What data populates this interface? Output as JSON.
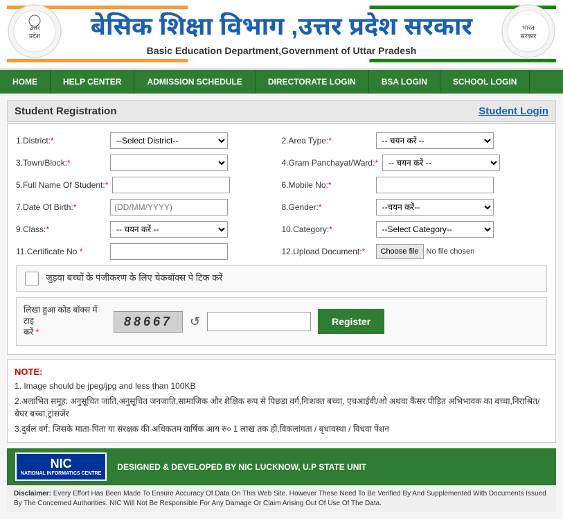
{
  "header": {
    "title": "बेसिक शिक्षा विभाग ,उत्तर प्रदेश सरकार",
    "subtitle": "Basic Education Department,Government of Uttar Pradesh"
  },
  "nav": {
    "items": [
      {
        "label": "HOME",
        "id": "home"
      },
      {
        "label": "HELP CENTER",
        "id": "help"
      },
      {
        "label": "ADMISSION SCHEDULE",
        "id": "admission"
      },
      {
        "label": "DIRECTORATE LOGIN",
        "id": "directorate"
      },
      {
        "label": "BSA LOGIN",
        "id": "bsa"
      },
      {
        "label": "SCHOOL LOGIN",
        "id": "school"
      }
    ]
  },
  "form": {
    "section_title": "Student Registration",
    "login_link": "Student Login",
    "fields": {
      "district_label": "1.District:",
      "district_placeholder": "--Select District--",
      "area_type_label": "2.Area Type:",
      "area_type_placeholder": "-- चयन करें --",
      "town_block_label": "3.Town/Block:",
      "gram_panchayat_label": "4.Gram Panchayat/Ward:",
      "gram_panchayat_placeholder": "-- चयन करें --",
      "full_name_label": "5.Full Name Of Student:",
      "mobile_label": "6.Mobile No:",
      "dob_label": "7.Date Of Birth:",
      "dob_placeholder": "(DD/MM/YYYY)",
      "gender_label": "8.Gender:",
      "gender_placeholder": "--चयन करें--",
      "class_label": "9.Class:",
      "class_placeholder": "-- चयन करें --",
      "category_label": "10.Category:",
      "category_placeholder": "--Select Category--",
      "certificate_label": "11.Certificate No",
      "upload_label": "12.Upload Document:",
      "choose_file_btn": "Choose file",
      "no_file_text": "No file chosen"
    },
    "twin_label": "जुड़वा बच्चों के पंजीकरण के लिए चेकबॉक्स पे टिक करें",
    "captcha_label": "लिखा हुआ कोड बॉक्स में टाइ करें",
    "captcha_required": "*",
    "captcha_value": "88667",
    "register_btn": "Register"
  },
  "notes": {
    "heading": "NOTE:",
    "items": [
      "1. Image should be jpeg/jpg and less than 100KB",
      "2.अलाभित समूह: अनुसूचित जाति,अनुसूचित जनजाति,सामाजिक और शैक्षिक रूप से पिछड़ा वर्ग,निःशक्त बच्चा, एचआईवी/ओ अथवा कैंसर पीड़ित अभिभावक का बच्चा,निराश्रित/बेघर बच्चा,ट्रांसजेंर",
      "3.दुर्बल वर्ग: जिसके माता-पिता या संरक्षक की अधिकतम वार्षिक आय रु० 1 लाख तक हो,विकलांगता / बृधावस्था / विधवा पेंशन"
    ]
  },
  "footer": {
    "nic_label": "NIC",
    "nic_full": "NATIONAL INFORMATICS CENTRE",
    "footer_text": "DESIGNED & DEVELOPED BY NIC LUCKNOW, U.P STATE UNIT",
    "disclaimer": "Disclaimer: Every Effort Has Been Made To Ensure Accuracy Of Data On This Web Site. However These Need To Be Verified By And Supplemented With Documents Issued By The Concerned Authorities. NIC Will Not Be Responsible For Any Damage Or Claim Arising Out Of Use Of The Data."
  }
}
